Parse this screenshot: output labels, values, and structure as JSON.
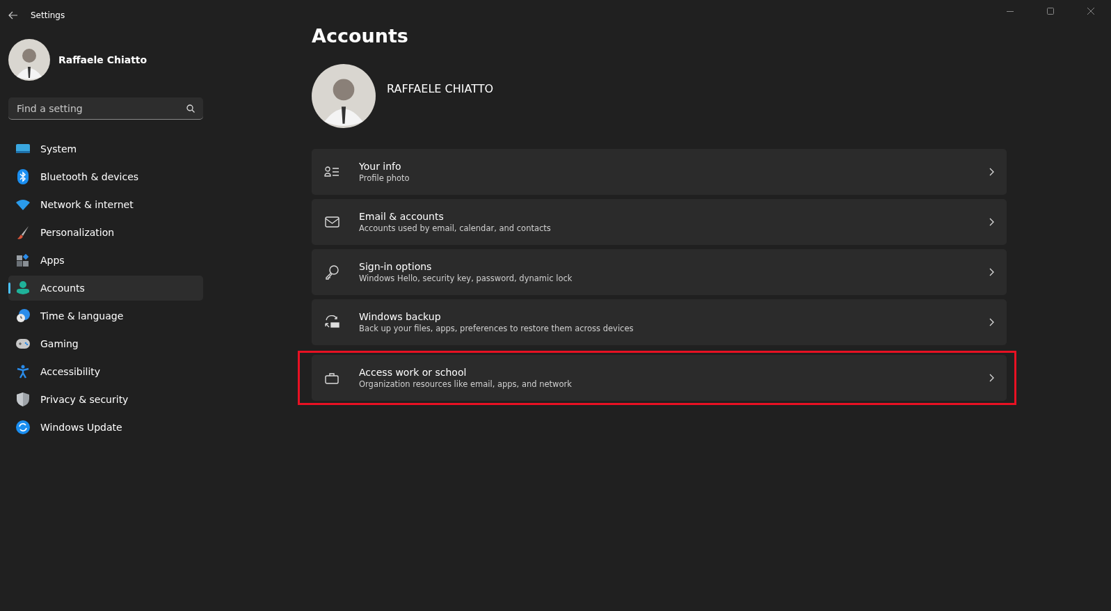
{
  "window": {
    "title": "Settings"
  },
  "user": {
    "name": "Raffaele Chiatto"
  },
  "search": {
    "placeholder": "Find a setting"
  },
  "sidebar": {
    "items": [
      {
        "label": "System",
        "selected": false
      },
      {
        "label": "Bluetooth & devices",
        "selected": false
      },
      {
        "label": "Network & internet",
        "selected": false
      },
      {
        "label": "Personalization",
        "selected": false
      },
      {
        "label": "Apps",
        "selected": false
      },
      {
        "label": "Accounts",
        "selected": true
      },
      {
        "label": "Time & language",
        "selected": false
      },
      {
        "label": "Gaming",
        "selected": false
      },
      {
        "label": "Accessibility",
        "selected": false
      },
      {
        "label": "Privacy & security",
        "selected": false
      },
      {
        "label": "Windows Update",
        "selected": false
      }
    ]
  },
  "page": {
    "title": "Accounts",
    "account_name": "RAFFAELE CHIATTO"
  },
  "cards": [
    {
      "title": "Your info",
      "subtitle": "Profile photo",
      "highlighted": false
    },
    {
      "title": "Email & accounts",
      "subtitle": "Accounts used by email, calendar, and contacts",
      "highlighted": false
    },
    {
      "title": "Sign-in options",
      "subtitle": "Windows Hello, security key, password, dynamic lock",
      "highlighted": false
    },
    {
      "title": "Windows backup",
      "subtitle": "Back up your files, apps, preferences to restore them across devices",
      "highlighted": false
    },
    {
      "title": "Access work or school",
      "subtitle": "Organization resources like email, apps, and network",
      "highlighted": true
    }
  ]
}
